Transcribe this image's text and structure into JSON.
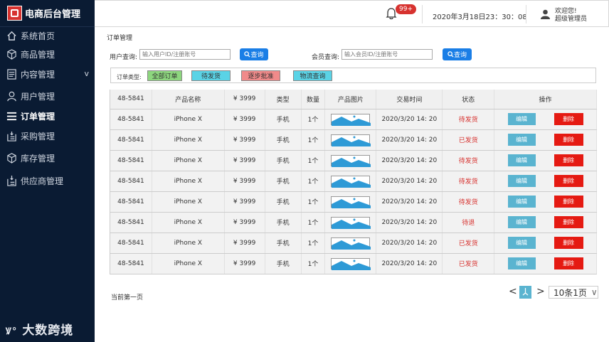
{
  "app": {
    "title": "电商后台管理",
    "footer_logo": "大数跨境"
  },
  "sidebar": {
    "items": [
      {
        "label": "系统首页",
        "icon": "home-icon"
      },
      {
        "label": "商品管理",
        "icon": "cube-icon"
      },
      {
        "label": "内容管理",
        "icon": "document-icon",
        "arrow": "v"
      },
      {
        "label": "用户管理",
        "icon": "user-icon"
      },
      {
        "label": "订单管理",
        "icon": "list-icon",
        "active": true
      },
      {
        "label": "采购管理",
        "icon": "purchase-icon"
      },
      {
        "label": "库存管理",
        "icon": "box-icon"
      },
      {
        "label": "供应商管理",
        "icon": "supplier-icon"
      }
    ]
  },
  "topbar": {
    "notifications": "99+",
    "datetime": "2020年3月18日23：30：08",
    "welcome": "欢迎您!",
    "role": "超级管理员"
  },
  "page": {
    "breadcrumb": "订单管理"
  },
  "search": {
    "user_label": "用户查询:",
    "user_placeholder": "输入用户ID/注册账号",
    "member_label": "会员查询:",
    "member_placeholder": "输入会员ID/注册账号",
    "query_label": "查询"
  },
  "filters": {
    "label": "订单类型:",
    "options": [
      {
        "label": "全部订单",
        "color": "#8dd67e"
      },
      {
        "label": "待发货",
        "color": "#5ad3e6"
      },
      {
        "label": "逐步批准",
        "color": "#f08a8a"
      },
      {
        "label": "物流查询",
        "color": "#5ad3e6"
      }
    ]
  },
  "table": {
    "headers": [
      "48-5841",
      "产品名称",
      "¥ 3999",
      "类型",
      "数量",
      "产品图片",
      "交易时间",
      "状态",
      "操作"
    ],
    "rows": [
      {
        "id": "48-5841",
        "name": "iPhone X",
        "price": "¥ 3999",
        "type": "手机",
        "qty": "1个",
        "time": "2020/3/20 14: 20",
        "status": "待发货"
      },
      {
        "id": "48-5841",
        "name": "iPhone X",
        "price": "¥ 3999",
        "type": "手机",
        "qty": "1个",
        "time": "2020/3/20 14: 20",
        "status": "已发货"
      },
      {
        "id": "48-5841",
        "name": "iPhone X",
        "price": "¥ 3999",
        "type": "手机",
        "qty": "1个",
        "time": "2020/3/20 14: 20",
        "status": "待发货"
      },
      {
        "id": "48-5841",
        "name": "iPhone X",
        "price": "¥ 3999",
        "type": "手机",
        "qty": "1个",
        "time": "2020/3/20 14: 20",
        "status": "待发货"
      },
      {
        "id": "48-5841",
        "name": "iPhone X",
        "price": "¥ 3999",
        "type": "手机",
        "qty": "1个",
        "time": "2020/3/20 14: 20",
        "status": "待发货"
      },
      {
        "id": "48-5841",
        "name": "iPhone X",
        "price": "¥ 3999",
        "type": "手机",
        "qty": "1个",
        "time": "2020/3/20 14: 20",
        "status": "待退"
      },
      {
        "id": "48-5841",
        "name": "iPhone X",
        "price": "¥ 3999",
        "type": "手机",
        "qty": "1个",
        "time": "2020/3/20 14: 20",
        "status": "已发货"
      },
      {
        "id": "48-5841",
        "name": "iPhone X",
        "price": "¥ 3999",
        "type": "手机",
        "qty": "1个",
        "time": "2020/3/20 14: 20",
        "status": "已发货"
      }
    ],
    "edit_label": "编辑",
    "delete_label": "删除"
  },
  "pagination": {
    "current_text": "当前第一页",
    "prev": "<",
    "next": ">",
    "page_size": "10条1页",
    "page_size_arrow": "∨"
  }
}
